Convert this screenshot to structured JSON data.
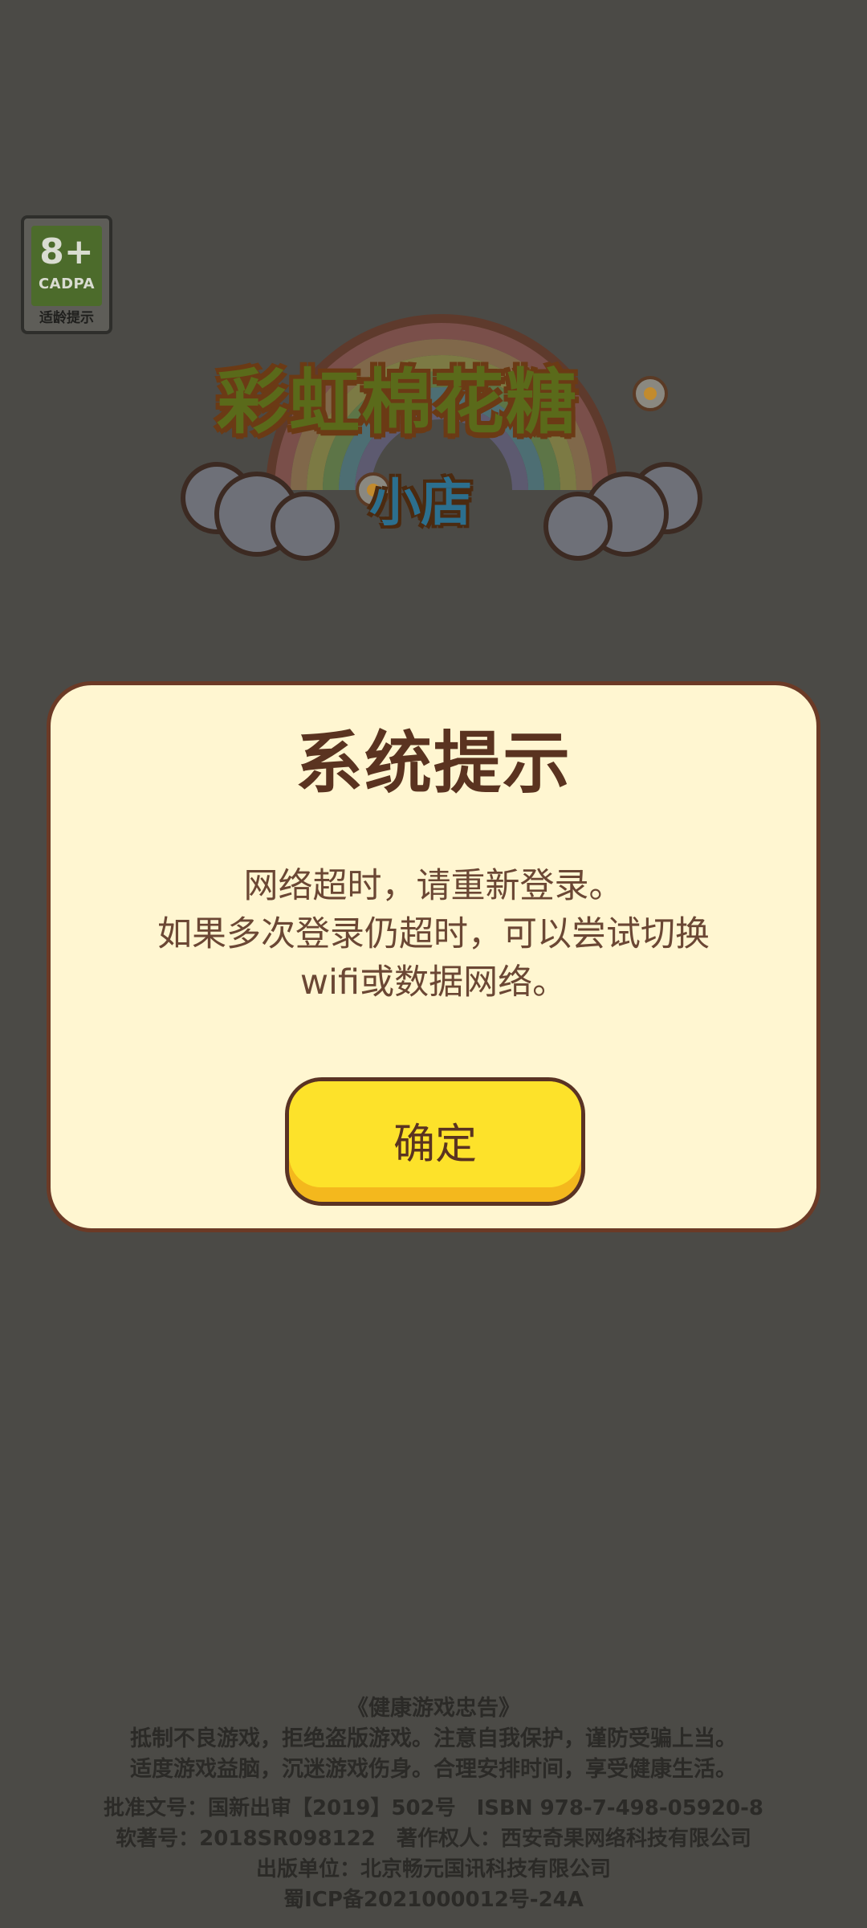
{
  "age_rating": {
    "number": "8+",
    "org": "CADPA",
    "tip": "适龄提示"
  },
  "logo": {
    "title": "彩虹棉花糖",
    "subtitle": "小店"
  },
  "dialog": {
    "title": "系统提示",
    "message_lines": [
      "网络超时，请重新登录。",
      "如果多次登录仍超时，可以尝试切换",
      "wifi或数据网络。"
    ],
    "confirm_label": "确定"
  },
  "footer": {
    "advice_title": "《健康游戏忠告》",
    "advice_lines": [
      "抵制不良游戏，拒绝盗版游戏。注意自我保护，谨防受骗上当。",
      "适度游戏益脑，沉迷游戏伤身。合理安排时间，享受健康生活。"
    ],
    "info_lines": [
      "批准文号：国新出审【2019】502号　ISBN 978-7-498-05920-8",
      "软著号：2018SR098122　著作权人：西安奇果网络科技有限公司",
      "出版单位：北京畅元国讯科技有限公司",
      "蜀ICP备2021000012号-24A"
    ]
  }
}
